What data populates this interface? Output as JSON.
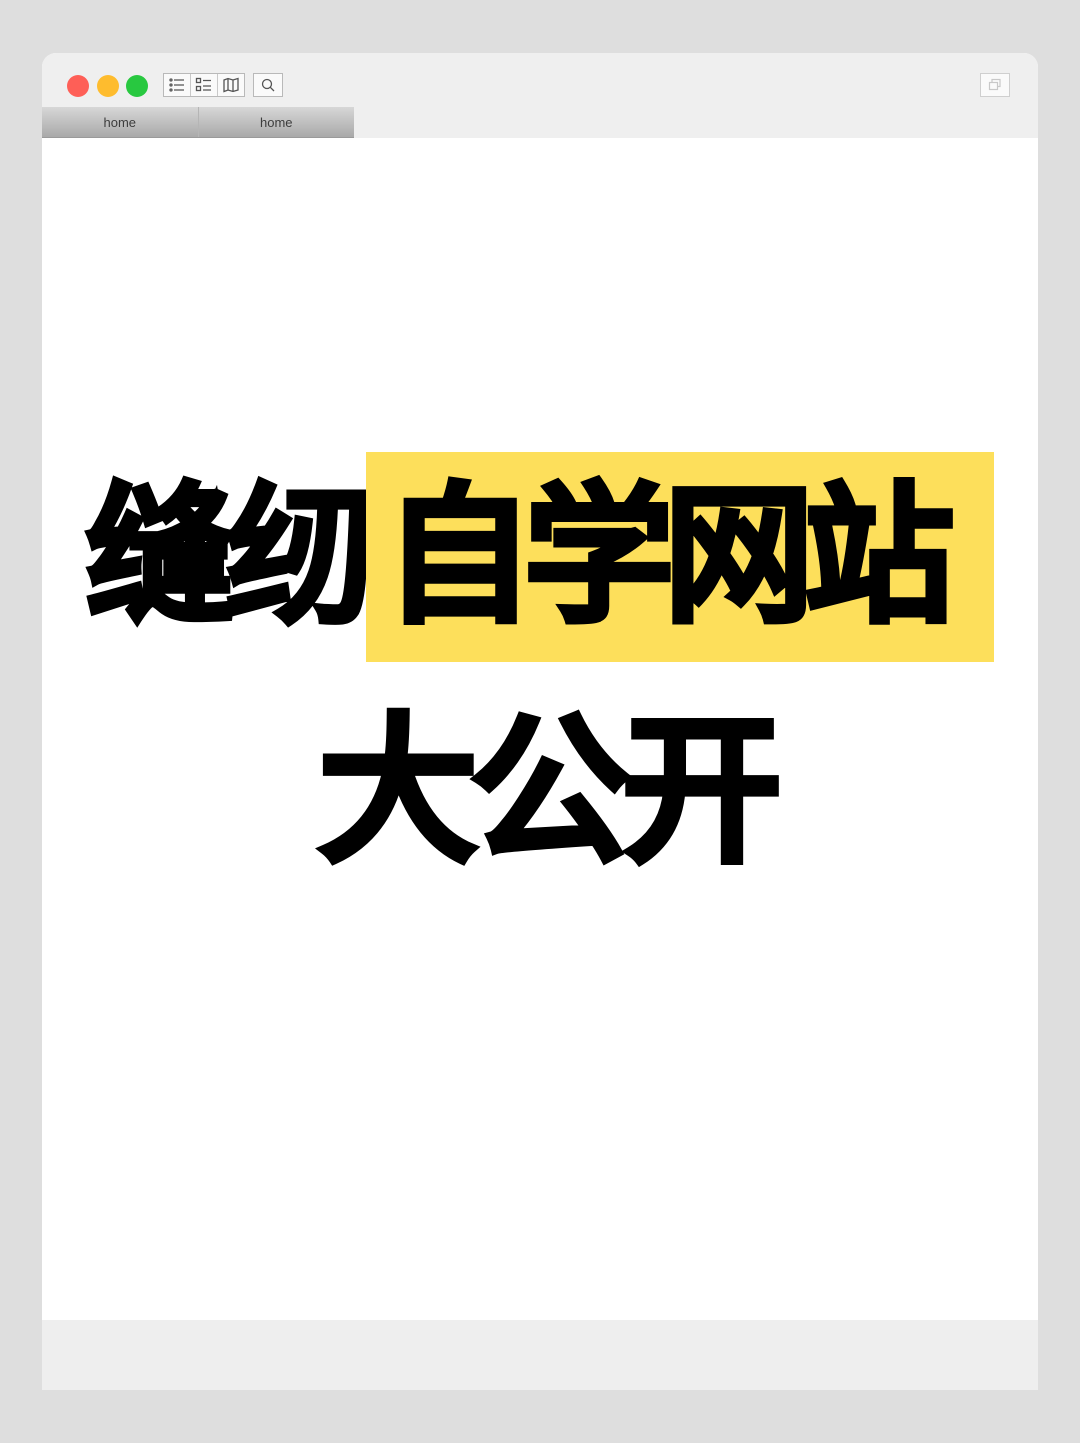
{
  "window": {
    "tabs": [
      {
        "label": "home"
      },
      {
        "label": "home"
      }
    ],
    "toolbar": {
      "icons": [
        "list-icon",
        "checklist-icon",
        "map-icon"
      ],
      "search_icon": "search-icon",
      "window_icon": "restore-window-icon"
    },
    "traffic_lights": {
      "close": "#fe5f57",
      "minimize": "#febc2e",
      "zoom": "#28c840"
    }
  },
  "headline": {
    "line1_plain": "缝纫",
    "line1_highlight": "自学网站",
    "line2": "大公开",
    "highlight_color": "#fddf5b"
  }
}
